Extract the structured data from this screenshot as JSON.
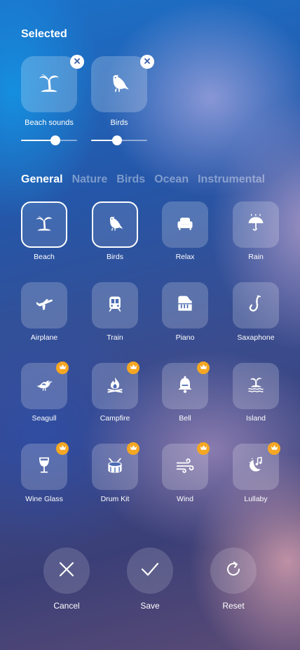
{
  "header": {
    "title": "Selected"
  },
  "selected": [
    {
      "label": "Beach sounds",
      "icon": "palm-island-icon",
      "volume": 0.62
    },
    {
      "label": "Birds",
      "icon": "bird-icon",
      "volume": 0.46
    }
  ],
  "tabs": [
    {
      "label": "General",
      "active": true
    },
    {
      "label": "Nature",
      "active": false
    },
    {
      "label": "Birds",
      "active": false
    },
    {
      "label": "Ocean",
      "active": false
    },
    {
      "label": "Instrumental",
      "active": false
    }
  ],
  "sounds": [
    {
      "label": "Beach",
      "icon": "palm-island-icon",
      "selected": true,
      "premium": false
    },
    {
      "label": "Birds",
      "icon": "bird-icon",
      "selected": true,
      "premium": false
    },
    {
      "label": "Relax",
      "icon": "armchair-icon",
      "selected": false,
      "premium": false
    },
    {
      "label": "Rain",
      "icon": "umbrella-rain-icon",
      "selected": false,
      "premium": false
    },
    {
      "label": "Airplane",
      "icon": "airplane-icon",
      "selected": false,
      "premium": false
    },
    {
      "label": "Train",
      "icon": "train-icon",
      "selected": false,
      "premium": false
    },
    {
      "label": "Piano",
      "icon": "piano-icon",
      "selected": false,
      "premium": false
    },
    {
      "label": "Saxaphone",
      "icon": "saxophone-icon",
      "selected": false,
      "premium": false
    },
    {
      "label": "Seagull",
      "icon": "seagull-icon",
      "selected": false,
      "premium": true
    },
    {
      "label": "Campfire",
      "icon": "campfire-icon",
      "selected": false,
      "premium": true
    },
    {
      "label": "Bell",
      "icon": "bell-icon",
      "selected": false,
      "premium": true
    },
    {
      "label": "Island",
      "icon": "island-icon",
      "selected": false,
      "premium": false
    },
    {
      "label": "Wine Glass",
      "icon": "wine-glass-icon",
      "selected": false,
      "premium": true
    },
    {
      "label": "Drum Kit",
      "icon": "drum-icon",
      "selected": false,
      "premium": true
    },
    {
      "label": "Wind",
      "icon": "wind-icon",
      "selected": false,
      "premium": true
    },
    {
      "label": "Lullaby",
      "icon": "moon-note-icon",
      "selected": false,
      "premium": true
    }
  ],
  "actions": [
    {
      "label": "Cancel",
      "icon": "close-icon"
    },
    {
      "label": "Save",
      "icon": "checkmark-icon"
    },
    {
      "label": "Reset",
      "icon": "refresh-icon"
    }
  ],
  "colors": {
    "crown_badge": "#f5a623",
    "selected_border": "#ffffff"
  }
}
